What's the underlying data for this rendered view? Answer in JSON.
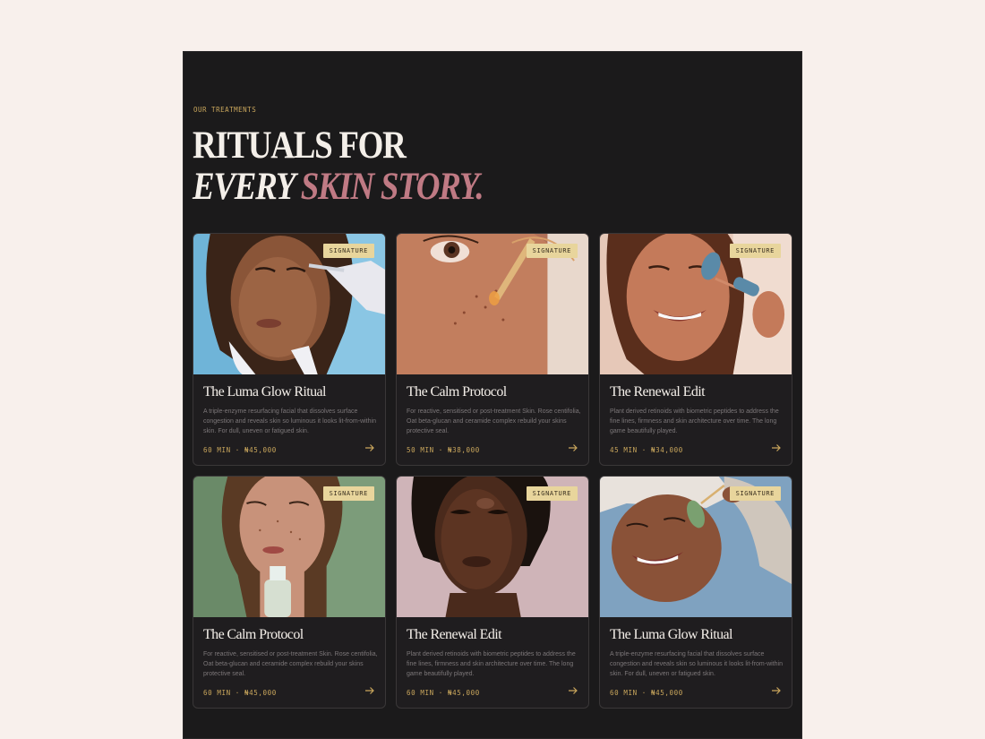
{
  "section": {
    "eyebrow": "OUR TREATMENTS",
    "heading_line1": "RITUALS FOR",
    "heading_line2_a": "EVERY",
    "heading_line2_b": "SKIN STORY.",
    "accent_color": "#c07a84",
    "gold_color": "#c9a65c"
  },
  "cards": [
    {
      "badge": "SIGNATURE",
      "title": "The Luma Glow Ritual",
      "description": "A triple-enzyme resurfacing facial that dissolves surface congestion and reveals skin so luminous it looks lit-from-within skin. For dull, uneven or fatigued skin.",
      "meta": "60 MIN · ₦45,000",
      "photo": "woman-eyes-closed-microneedle-treatment",
      "arrow_icon": "arrow-right-icon"
    },
    {
      "badge": "SIGNATURE",
      "title": "The Calm Protocol",
      "description": "For reactive, sensitised or post-treatment Skin. Rose centifolia, Oat beta-glucan and ceramide complex rebuild your skins protective seal.",
      "meta": "50 MIN · ₦38,000",
      "photo": "close-up-dropper-serum-on-cheek",
      "arrow_icon": "arrow-right-icon"
    },
    {
      "badge": "SIGNATURE",
      "title": "The Renewal Edit",
      "description": "Plant derived retinoids with biometric peptides to address the fine lines, firmness and skin architecture over time. The long game beautifully played.",
      "meta": "45 MIN · ₦34,000",
      "photo": "woman-smiling-blue-face-roller",
      "arrow_icon": "arrow-right-icon"
    },
    {
      "badge": "SIGNATURE",
      "title": "The Calm Protocol",
      "description": "For reactive, sensitised or post-treatment Skin. Rose centifolia, Oat beta-glucan and ceramide complex rebuild your skins protective seal.",
      "meta": "60 MIN · ₦45,000",
      "photo": "freckled-woman-with-pump-bottle",
      "arrow_icon": "arrow-right-icon"
    },
    {
      "badge": "SIGNATURE",
      "title": "The Renewal Edit",
      "description": "Plant derived retinoids with biometric peptides to address the fine lines, firmness and skin architecture over time. The long game beautifully played.",
      "meta": "60 MIN · ₦45,000",
      "photo": "portrait-glowing-skin-pink-background",
      "arrow_icon": "arrow-right-icon"
    },
    {
      "badge": "SIGNATURE",
      "title": "The Luma Glow Ritual",
      "description": "A triple-enzyme resurfacing facial that dissolves surface congestion and reveals skin so luminous it looks lit-from-within skin. For dull, uneven or fatigued skin.",
      "meta": "60 MIN · ₦45,000",
      "photo": "woman-towel-jade-roller",
      "arrow_icon": "arrow-right-icon"
    }
  ]
}
